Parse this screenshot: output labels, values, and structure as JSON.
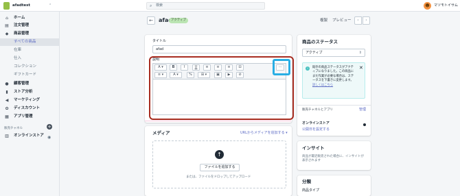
{
  "topbar": {
    "store_name": "afadtest",
    "store_caret": "⌃",
    "search_placeholder": "検索",
    "user_name": "マツモトイサム",
    "avatar_initial": "☻"
  },
  "sidebar": {
    "items": [
      {
        "label": "ホーム",
        "icon": "⌂"
      },
      {
        "label": "注文管理",
        "icon": "▤"
      },
      {
        "label": "商品管理",
        "icon": "◆"
      },
      {
        "label": "すべての商品"
      },
      {
        "label": "在庫"
      },
      {
        "label": "仕入"
      },
      {
        "label": "コレクション"
      },
      {
        "label": "ギフトカード"
      },
      {
        "label": "顧客管理",
        "icon": "●"
      },
      {
        "label": "ストア分析",
        "icon": "▮"
      },
      {
        "label": "マーケティング",
        "icon": "◀"
      },
      {
        "label": "ディスカウント",
        "icon": "✿"
      },
      {
        "label": "アプリ管理",
        "icon": "▦"
      }
    ],
    "channels_heading": "販売チャネル",
    "channels_add": "+",
    "online_store": {
      "label": "オンラインストア",
      "icon": "▥",
      "eye": "◉"
    }
  },
  "header": {
    "back": "←",
    "title": "afad",
    "status_badge": "アクティブ",
    "duplicate": "複製",
    "preview": "プレビュー",
    "prev": "‹",
    "next": "›"
  },
  "main_card": {
    "title_label": "タイトル",
    "title_value": "afad",
    "description_label": "説明",
    "toolbar_row1": [
      "A ▾",
      "B",
      "I",
      "U",
      "≡",
      "≡",
      "≡",
      "⊟"
    ],
    "more_button": "···",
    "toolbar_row2": [
      "≡ ▾",
      "A ▾",
      "%",
      "⊞ ▾",
      "▣",
      "▶",
      "⊘"
    ]
  },
  "media_card": {
    "heading": "メディア",
    "url_link": "URLからメディアを追加する ▾",
    "upload_icon": "↑",
    "add_file_button": "ファイルを追加する",
    "drop_hint": "または、ファイルをドロップしてアップロード"
  },
  "status_card": {
    "heading": "商品のステータス",
    "selected_status": "アクティブ",
    "select_caret": "⇕",
    "info_icon": "i",
    "banner_text": "既存の商品ステータスがアクティブになりました。この商品にまだ作業が必要な場合は、ステータスを下書きに変更します。",
    "banner_link": "詳しくはこちら",
    "banner_close": "✕",
    "channels_heading": "販売チャネルとアプリ",
    "manage_link": "管理",
    "online_store": "オンラインストア",
    "schedule_link": "公開日を設定する"
  },
  "insights_card": {
    "heading": "インサイト",
    "text": "商品が最近販売された場合に、インサイトが表示されます"
  },
  "classification_card": {
    "heading": "分類",
    "product_type_label": "商品タイプ"
  },
  "colors": {
    "accent": "#5c6ac4",
    "active_badge": "#bbe5b3",
    "annotation_red": "#a72b1f",
    "annotation_blue": "#29aee4"
  }
}
